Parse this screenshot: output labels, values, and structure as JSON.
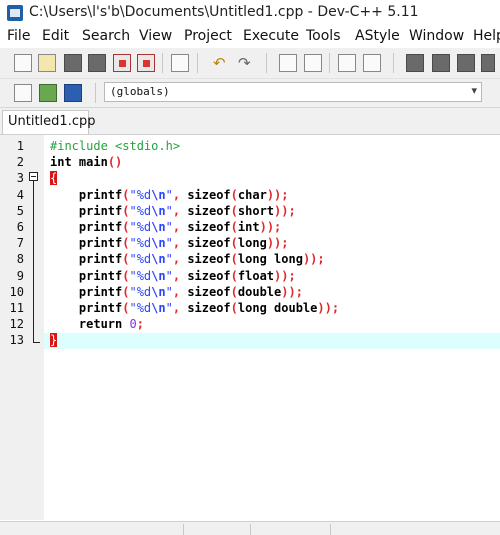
{
  "window": {
    "title": "C:\\Users\\l's'b\\Documents\\Untitled1.cpp - Dev-C++ 5.11"
  },
  "menu": [
    "File",
    "Edit",
    "Search",
    "View",
    "Project",
    "Execute",
    "Tools",
    "AStyle",
    "Window",
    "Help"
  ],
  "toolbar": {
    "icons": [
      "new-file-icon",
      "open-file-icon",
      "save-icon",
      "save-all-icon",
      "close-icon",
      "close-all-icon",
      "print-icon",
      "undo-icon",
      "redo-icon",
      "find-icon",
      "replace-icon",
      "goto-icon",
      "indent-icon",
      "compile-icon",
      "run-icon",
      "compile-run-icon",
      "rebuild-icon"
    ]
  },
  "toolbar2": {
    "icons": [
      "new-class-icon",
      "insert-icon",
      "bookmark-icon"
    ],
    "scope_value": "(globals)"
  },
  "tabs": [
    {
      "label": "Untitled1.cpp"
    }
  ],
  "editor": {
    "line_numbers": [
      "1",
      "2",
      "3",
      "4",
      "5",
      "6",
      "7",
      "8",
      "9",
      "10",
      "11",
      "12",
      "13"
    ],
    "lines": [
      [
        {
          "t": "#include <stdio.h>",
          "c": "pp"
        }
      ],
      [
        {
          "t": "int",
          "c": "kw"
        },
        {
          "t": " "
        },
        {
          "t": "main",
          "c": "kw"
        },
        {
          "t": "()",
          "c": "sym"
        }
      ],
      [
        {
          "t": "{",
          "c": "brace-hl"
        }
      ],
      [
        {
          "t": "    printf",
          "c": "kw"
        },
        {
          "t": "(",
          "c": "sym"
        },
        {
          "t": "\"%d",
          "c": "str"
        },
        {
          "t": "\\n",
          "c": "esc"
        },
        {
          "t": "\"",
          "c": "str"
        },
        {
          "t": ", ",
          "c": "sym"
        },
        {
          "t": "sizeof",
          "c": "kw"
        },
        {
          "t": "(",
          "c": "sym"
        },
        {
          "t": "char",
          "c": "kw"
        },
        {
          "t": "));",
          "c": "sym"
        }
      ],
      [
        {
          "t": "    printf",
          "c": "kw"
        },
        {
          "t": "(",
          "c": "sym"
        },
        {
          "t": "\"%d",
          "c": "str"
        },
        {
          "t": "\\n",
          "c": "esc"
        },
        {
          "t": "\"",
          "c": "str"
        },
        {
          "t": ", ",
          "c": "sym"
        },
        {
          "t": "sizeof",
          "c": "kw"
        },
        {
          "t": "(",
          "c": "sym"
        },
        {
          "t": "short",
          "c": "kw"
        },
        {
          "t": "));",
          "c": "sym"
        }
      ],
      [
        {
          "t": "    printf",
          "c": "kw"
        },
        {
          "t": "(",
          "c": "sym"
        },
        {
          "t": "\"%d",
          "c": "str"
        },
        {
          "t": "\\n",
          "c": "esc"
        },
        {
          "t": "\"",
          "c": "str"
        },
        {
          "t": ", ",
          "c": "sym"
        },
        {
          "t": "sizeof",
          "c": "kw"
        },
        {
          "t": "(",
          "c": "sym"
        },
        {
          "t": "int",
          "c": "kw"
        },
        {
          "t": "));",
          "c": "sym"
        }
      ],
      [
        {
          "t": "    printf",
          "c": "kw"
        },
        {
          "t": "(",
          "c": "sym"
        },
        {
          "t": "\"%d",
          "c": "str"
        },
        {
          "t": "\\n",
          "c": "esc"
        },
        {
          "t": "\"",
          "c": "str"
        },
        {
          "t": ", ",
          "c": "sym"
        },
        {
          "t": "sizeof",
          "c": "kw"
        },
        {
          "t": "(",
          "c": "sym"
        },
        {
          "t": "long",
          "c": "kw"
        },
        {
          "t": "));",
          "c": "sym"
        }
      ],
      [
        {
          "t": "    printf",
          "c": "kw"
        },
        {
          "t": "(",
          "c": "sym"
        },
        {
          "t": "\"%d",
          "c": "str"
        },
        {
          "t": "\\n",
          "c": "esc"
        },
        {
          "t": "\"",
          "c": "str"
        },
        {
          "t": ", ",
          "c": "sym"
        },
        {
          "t": "sizeof",
          "c": "kw"
        },
        {
          "t": "(",
          "c": "sym"
        },
        {
          "t": "long long",
          "c": "kw"
        },
        {
          "t": "));",
          "c": "sym"
        }
      ],
      [
        {
          "t": "    printf",
          "c": "kw"
        },
        {
          "t": "(",
          "c": "sym"
        },
        {
          "t": "\"%d",
          "c": "str"
        },
        {
          "t": "\\n",
          "c": "esc"
        },
        {
          "t": "\"",
          "c": "str"
        },
        {
          "t": ", ",
          "c": "sym"
        },
        {
          "t": "sizeof",
          "c": "kw"
        },
        {
          "t": "(",
          "c": "sym"
        },
        {
          "t": "float",
          "c": "kw"
        },
        {
          "t": "));",
          "c": "sym"
        }
      ],
      [
        {
          "t": "    printf",
          "c": "kw"
        },
        {
          "t": "(",
          "c": "sym"
        },
        {
          "t": "\"%d",
          "c": "str"
        },
        {
          "t": "\\n",
          "c": "esc"
        },
        {
          "t": "\"",
          "c": "str"
        },
        {
          "t": ", ",
          "c": "sym"
        },
        {
          "t": "sizeof",
          "c": "kw"
        },
        {
          "t": "(",
          "c": "sym"
        },
        {
          "t": "double",
          "c": "kw"
        },
        {
          "t": "));",
          "c": "sym"
        }
      ],
      [
        {
          "t": "    printf",
          "c": "kw"
        },
        {
          "t": "(",
          "c": "sym"
        },
        {
          "t": "\"%d",
          "c": "str"
        },
        {
          "t": "\\n",
          "c": "esc"
        },
        {
          "t": "\"",
          "c": "str"
        },
        {
          "t": ", ",
          "c": "sym"
        },
        {
          "t": "sizeof",
          "c": "kw"
        },
        {
          "t": "(",
          "c": "sym"
        },
        {
          "t": "long double",
          "c": "kw"
        },
        {
          "t": "));",
          "c": "sym"
        }
      ],
      [
        {
          "t": "    return",
          "c": "kw"
        },
        {
          "t": " "
        },
        {
          "t": "0",
          "c": "num"
        },
        {
          "t": ";",
          "c": "sym"
        }
      ],
      [
        {
          "t": "}",
          "c": "brace-hl"
        }
      ]
    ]
  },
  "colors": {
    "current_line": "#dcfffe",
    "brace_highlight": "#d81414",
    "string": "#2b45ff",
    "preprocessor": "#26a23e",
    "symbol": "#e0282c",
    "number": "#8a2be2"
  }
}
